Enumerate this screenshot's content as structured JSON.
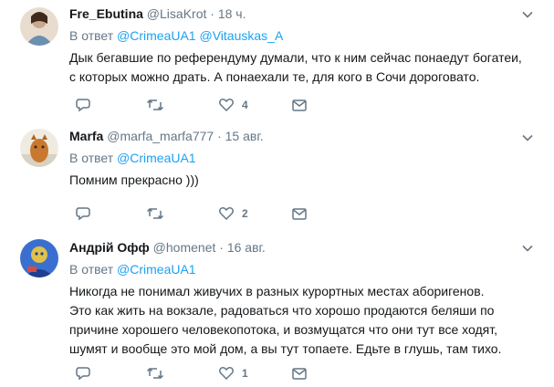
{
  "tweets": [
    {
      "name": "Fre_Ebutina",
      "handle": "@LisaKrot",
      "sep": "·",
      "time": "18 ч.",
      "reply_prefix": "В ответ",
      "mentions": [
        "@CrimeaUA1",
        "@Vitauskas_A"
      ],
      "text": "Дык бегавшие по референдуму думали, что к ним сейчас понаедут богатеи,\nс которых можно драть. А понаехали те, для кого в Сочи дороговато.",
      "reply_count": "",
      "retweet_count": "",
      "like_count": "4",
      "avatar_colors": [
        "#c9a98a",
        "#6b8fb0",
        "#e8dccf"
      ]
    },
    {
      "name": "Marfa",
      "handle": "@marfa_marfa777",
      "sep": "·",
      "time": "15 авг.",
      "reply_prefix": "В ответ",
      "mentions": [
        "@CrimeaUA1"
      ],
      "text": "Помним прекрасно )))",
      "reply_count": "",
      "retweet_count": "",
      "like_count": "2",
      "avatar_colors": [
        "#d8d2c4",
        "#c9782f",
        "#f0ebe1"
      ]
    },
    {
      "name": "Андрій Офф",
      "handle": "@homenet",
      "sep": "·",
      "time": "16 авг.",
      "reply_prefix": "В ответ",
      "mentions": [
        "@CrimeaUA1"
      ],
      "text": "Никогда не понимал живучих в разных курортных местах аборигенов.\nЭто как жить на вокзале, радоваться что хорошо продаются беляши по\nпричине хорошего человекопотока, и возмущатся что они тут все ходят,\nшумят и вообще это мой дом, а вы тут топаете. Едьте в глушь, там тихо.",
      "reply_count": "",
      "retweet_count": "",
      "like_count": "1",
      "avatar_colors": [
        "#1f3f8f",
        "#e0c14a",
        "#3a6fd0"
      ]
    }
  ],
  "colors": {
    "link": "#1da1f2",
    "muted": "#657786",
    "divider": "#e6ecf0"
  }
}
